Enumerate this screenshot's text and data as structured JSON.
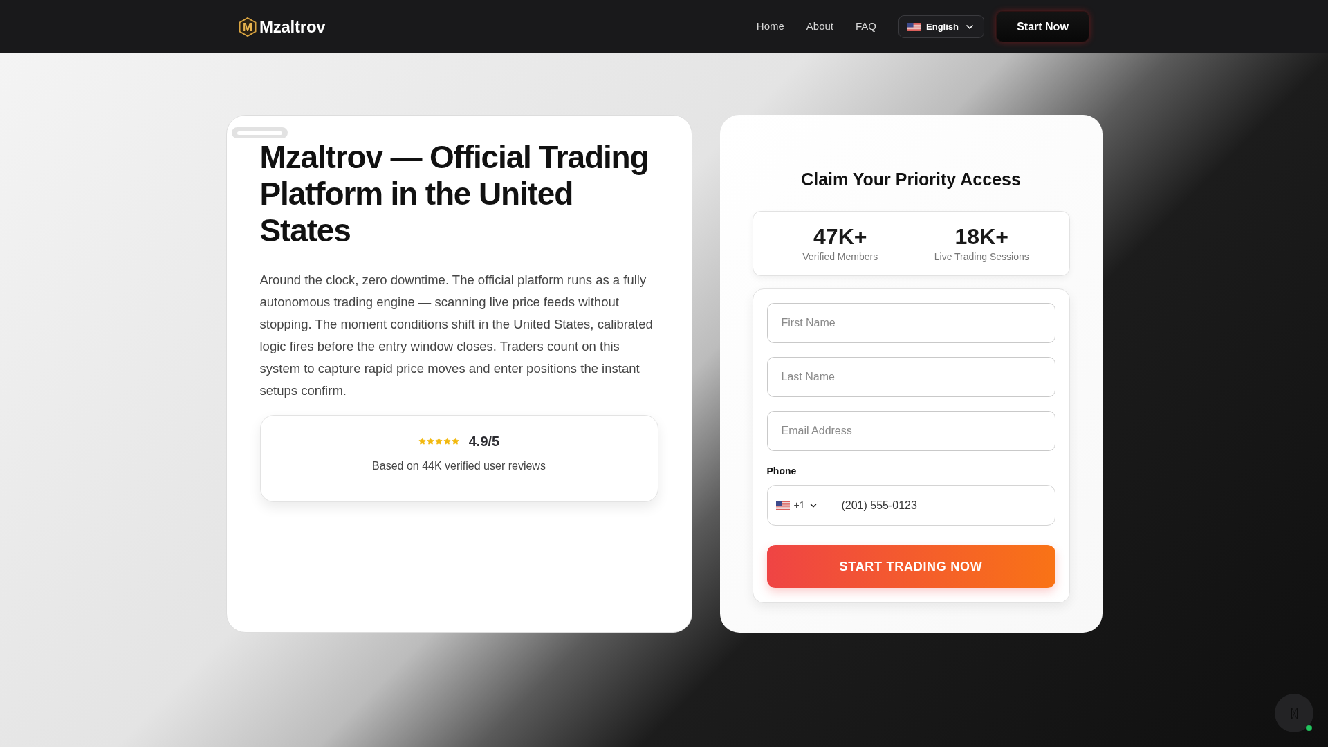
{
  "header": {
    "logo_letter": "M",
    "brand": "Mzaltrov",
    "nav": [
      "Home",
      "About",
      "FAQ"
    ],
    "language": {
      "label": "English"
    },
    "cta": "Start Now"
  },
  "hero": {
    "title": "Mzaltrov — Official Trading Platform in the United States",
    "description": "Around the clock, zero downtime. The official platform runs as a fully autonomous trading engine — scanning live price feeds without stopping. The moment conditions shift in the United States, calibrated logic fires before the entry window closes. Traders count on this system to capture rapid price moves and enter positions the instant setups confirm.",
    "rating": {
      "stars": 5,
      "score": "4.9/5",
      "caption": "Based on 44K verified user reviews"
    }
  },
  "signup": {
    "title": "Claim Your Priority Access",
    "stats": [
      {
        "value": "47K+",
        "label": "Verified Members"
      },
      {
        "value": "18K+",
        "label": "Live Trading Sessions"
      }
    ],
    "fields": [
      {
        "placeholder": "First Name"
      },
      {
        "placeholder": "Last Name"
      },
      {
        "placeholder": "Email Address"
      }
    ],
    "phone": {
      "label": "Phone",
      "country_code": "+1",
      "value": "(201) 555-0123"
    },
    "submit": "START TRADING NOW"
  },
  "chat_button": {
    "online": true
  }
}
